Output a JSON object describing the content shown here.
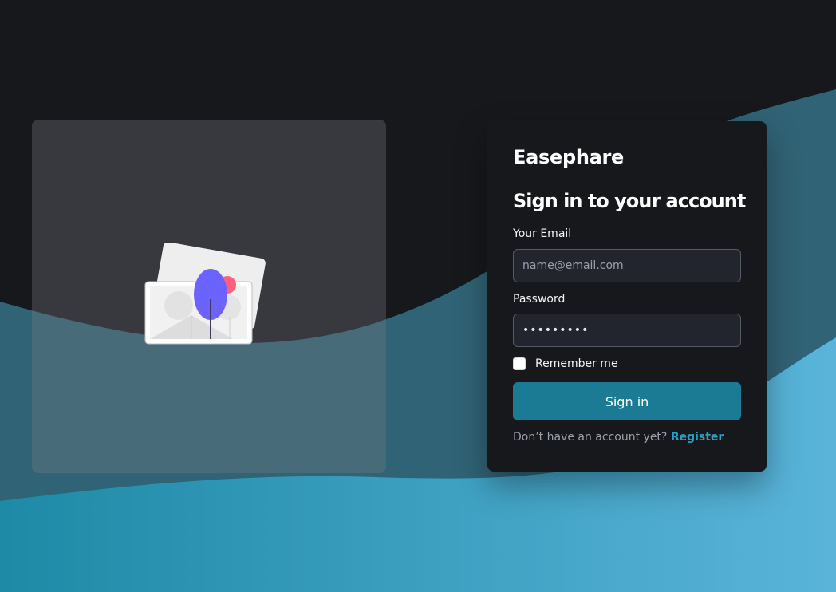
{
  "brand": {
    "name": "Easephare"
  },
  "login": {
    "heading": "Sign in to your account",
    "email_label": "Your Email",
    "email_placeholder": "name@email.com",
    "email_value": "",
    "password_label": "Password",
    "password_value": "•••••••••",
    "remember_label": "Remember me",
    "remember_checked": false,
    "submit_label": "Sign in",
    "no_account_text": "Don’t have an account yet?",
    "register_link": "Register"
  },
  "illustration": {
    "icon": "photo-cards-illustration"
  },
  "colors": {
    "background": "#17181c",
    "card": "#17181c",
    "input_bg": "#22252e",
    "button": "#1c7b94",
    "link": "#2aa0c2",
    "wave_dark": "#1e5c70",
    "wave_light": "#5ab3d8"
  }
}
